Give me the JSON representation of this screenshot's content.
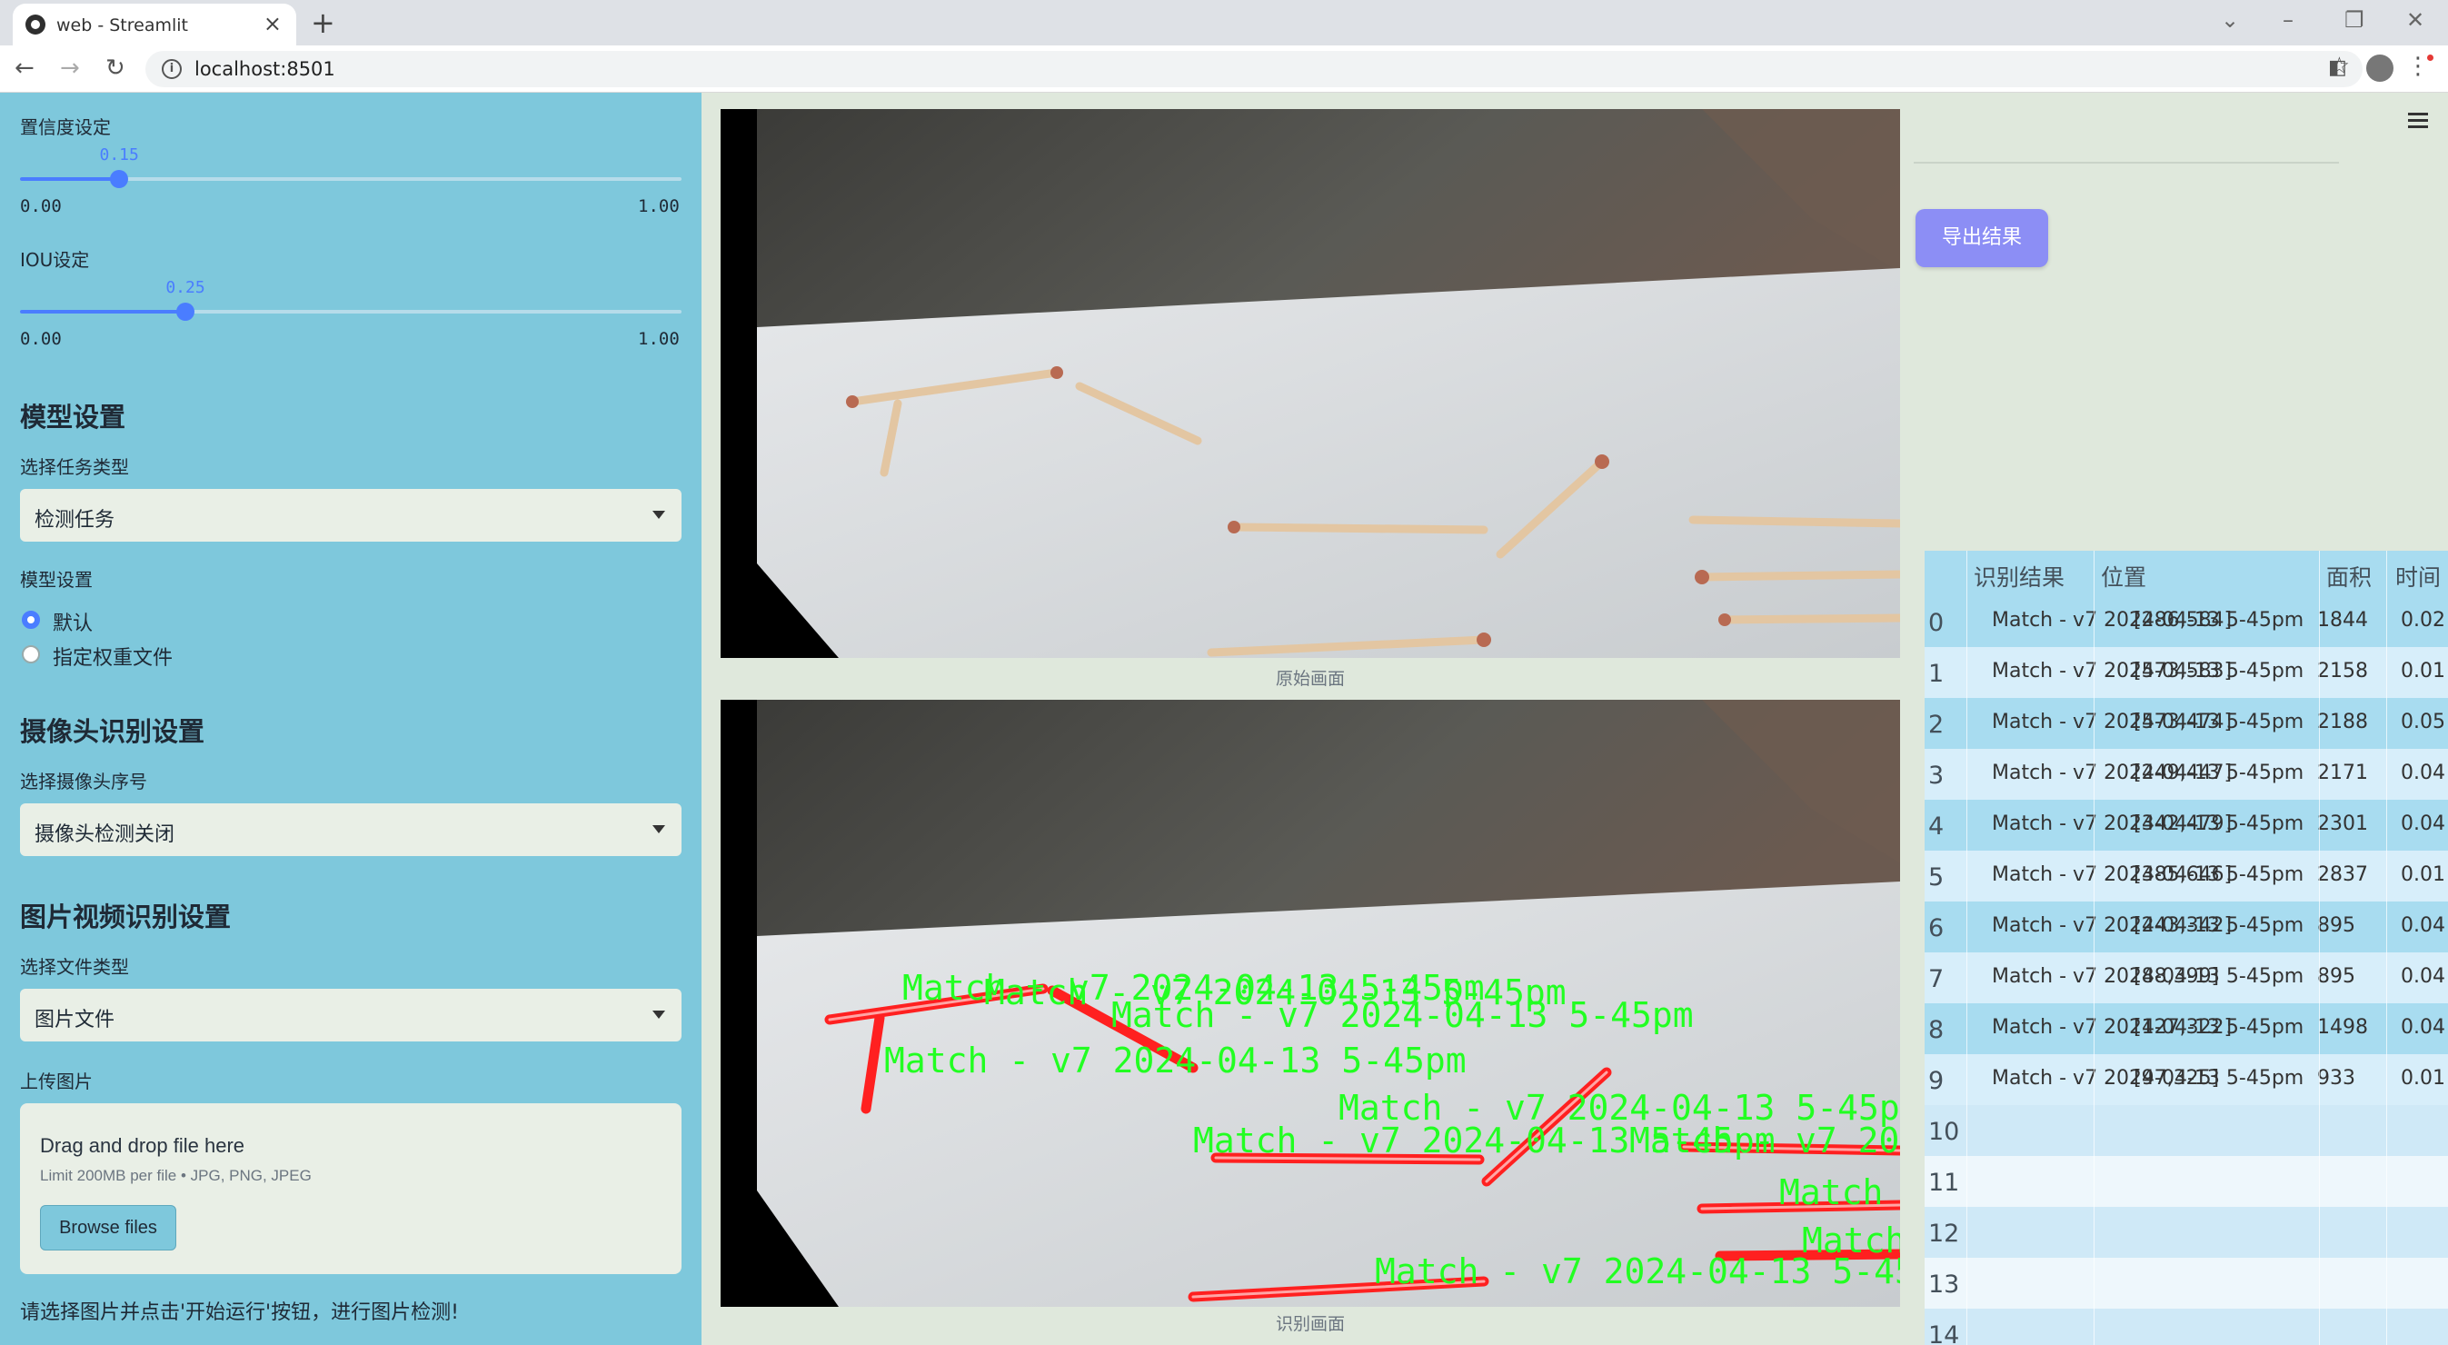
{
  "browser": {
    "tab_title": "web - Streamlit",
    "url": "localhost:8501"
  },
  "sidebar": {
    "confidence": {
      "label": "置信度设定",
      "value": "0.15",
      "min": "0.00",
      "max": "1.00",
      "fraction": 0.15
    },
    "iou": {
      "label": "IOU设定",
      "value": "0.25",
      "min": "0.00",
      "max": "1.00",
      "fraction": 0.25
    },
    "model_header": "模型设置",
    "task_label": "选择任务类型",
    "task_value": "检测任务",
    "model_label": "模型设置",
    "model_options": [
      "默认",
      "指定权重文件"
    ],
    "camera_header": "摄像头识别设置",
    "camera_label": "选择摄像头序号",
    "camera_value": "摄像头检测关闭",
    "file_header": "图片视频识别设置",
    "file_type_label": "选择文件类型",
    "file_type_value": "图片文件",
    "upload_label": "上传图片",
    "upload_title": "Drag and drop file here",
    "upload_sub": "Limit 200MB per file • JPG, PNG, JPEG",
    "browse_label": "Browse files",
    "hint": "请选择图片并点击'开始运行'按钮，进行图片检测!"
  },
  "main": {
    "original_caption": "原始画面",
    "result_caption": "识别画面",
    "detection_label": "Match - v7 2024-04-13 5-45pm",
    "export_label": "导出结果"
  },
  "table": {
    "headers": [
      "识别结果",
      "位置",
      "面积",
      "时间"
    ],
    "rows": [
      {
        "idx": "0",
        "result": "Match - v7 2024-04-13 5-45pm",
        "pos": "[286,584]",
        "area": "1844",
        "time": "0.02"
      },
      {
        "idx": "1",
        "result": "Match - v7 2024-04-13 5-45pm",
        "pos": "[573,583]",
        "area": "2158",
        "time": "0.01"
      },
      {
        "idx": "2",
        "result": "Match - v7 2024-04-13 5-45pm",
        "pos": "[573,474]",
        "area": "2188",
        "time": "0.05"
      },
      {
        "idx": "3",
        "result": "Match - v7 2024-04-13 5-45pm",
        "pos": "[249,447]",
        "area": "2171",
        "time": "0.04"
      },
      {
        "idx": "4",
        "result": "Match - v7 2024-04-13 5-45pm",
        "pos": "[342,479]",
        "area": "2301",
        "time": "0.04"
      },
      {
        "idx": "5",
        "result": "Match - v7 2024-04-13 5-45pm",
        "pos": "[385,646]",
        "area": "2837",
        "time": "0.01"
      },
      {
        "idx": "6",
        "result": "Match - v7 2024-04-13 5-45pm",
        "pos": "[243,342]",
        "area": "895",
        "time": "0.04"
      },
      {
        "idx": "7",
        "result": "Match - v7 2024-04-13 5-45pm",
        "pos": "[88,399]",
        "area": "895",
        "time": "0.04"
      },
      {
        "idx": "8",
        "result": "Match - v7 2024-04-13 5-45pm",
        "pos": "[127,322]",
        "area": "1498",
        "time": "0.04"
      },
      {
        "idx": "9",
        "result": "Match - v7 2024-04-13 5-45pm",
        "pos": "[97,325]",
        "area": "933",
        "time": "0.01"
      },
      {
        "idx": "10",
        "result": "",
        "pos": "",
        "area": "",
        "time": ""
      },
      {
        "idx": "11",
        "result": "",
        "pos": "",
        "area": "",
        "time": ""
      },
      {
        "idx": "12",
        "result": "",
        "pos": "",
        "area": "",
        "time": ""
      },
      {
        "idx": "13",
        "result": "",
        "pos": "",
        "area": "",
        "time": ""
      },
      {
        "idx": "14",
        "result": "",
        "pos": "",
        "area": "",
        "time": ""
      }
    ]
  },
  "colors": {
    "sidebar_bg": "#7ec8dc",
    "accent": "#4a7dff",
    "export_button": "#8c8ef5",
    "detection_box": "#ff2020",
    "detection_text": "#22ff22"
  }
}
